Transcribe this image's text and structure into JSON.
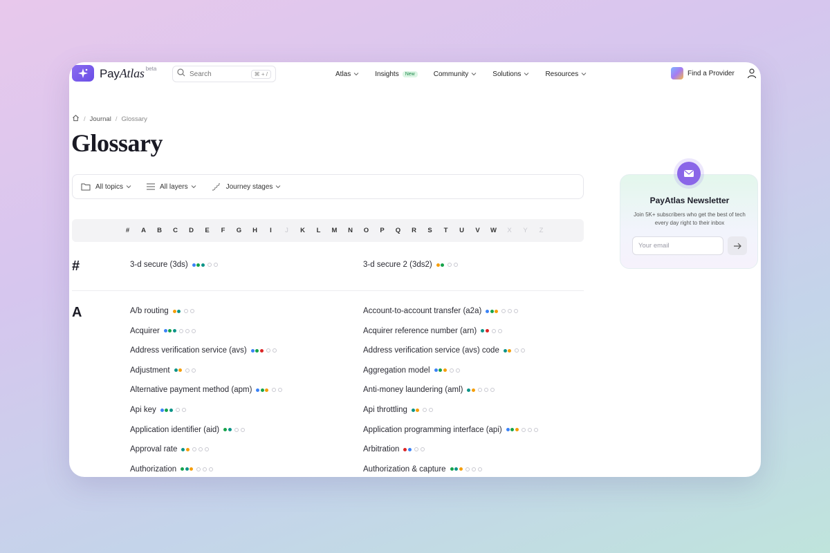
{
  "header": {
    "logo_text": "Pay",
    "logo_text_italic": "Atlas",
    "logo_badge": "beta",
    "search_placeholder": "Search",
    "search_shortcut": "⌘ + /",
    "nav": [
      {
        "label": "Atlas",
        "chevron": true
      },
      {
        "label": "Insights",
        "badge": "New"
      },
      {
        "label": "Community",
        "chevron": true
      },
      {
        "label": "Solutions",
        "chevron": true
      },
      {
        "label": "Resources",
        "chevron": true
      }
    ],
    "find_provider": "Find a Provider"
  },
  "breadcrumb": {
    "items": [
      "Journal",
      "Glossary"
    ]
  },
  "page_title": "Glossary",
  "filters": {
    "topics": "All topics",
    "layers": "All layers",
    "stages": "Journey stages"
  },
  "alphabet": [
    {
      "l": "#",
      "on": true
    },
    {
      "l": "A",
      "on": true
    },
    {
      "l": "B",
      "on": true
    },
    {
      "l": "C",
      "on": true
    },
    {
      "l": "D",
      "on": true
    },
    {
      "l": "E",
      "on": true
    },
    {
      "l": "F",
      "on": true
    },
    {
      "l": "G",
      "on": true
    },
    {
      "l": "H",
      "on": true
    },
    {
      "l": "I",
      "on": true
    },
    {
      "l": "J",
      "on": false
    },
    {
      "l": "K",
      "on": true
    },
    {
      "l": "L",
      "on": true
    },
    {
      "l": "M",
      "on": true
    },
    {
      "l": "N",
      "on": true
    },
    {
      "l": "O",
      "on": true
    },
    {
      "l": "P",
      "on": true
    },
    {
      "l": "Q",
      "on": true
    },
    {
      "l": "R",
      "on": true
    },
    {
      "l": "S",
      "on": true
    },
    {
      "l": "T",
      "on": true
    },
    {
      "l": "U",
      "on": true
    },
    {
      "l": "V",
      "on": true
    },
    {
      "l": "W",
      "on": true
    },
    {
      "l": "X",
      "on": false
    },
    {
      "l": "Y",
      "on": false
    },
    {
      "l": "Z",
      "on": false
    }
  ],
  "colors": {
    "blue": "#3b82f6",
    "green": "#16a34a",
    "teal": "#0d9488",
    "orange": "#f59e0b",
    "red": "#dc2626"
  },
  "sections": [
    {
      "letter": "#",
      "left": [
        {
          "term": "3-d secure (3ds)",
          "dots": [
            "blue",
            "green",
            "teal"
          ],
          "icons": 2
        }
      ],
      "right": [
        {
          "term": "3-d secure 2 (3ds2)",
          "dots": [
            "orange",
            "green"
          ],
          "icons": 2
        }
      ]
    },
    {
      "letter": "A",
      "left": [
        {
          "term": "A/b routing",
          "dots": [
            "orange",
            "teal"
          ],
          "icons": 2
        },
        {
          "term": "Acquirer",
          "dots": [
            "blue",
            "green",
            "teal"
          ],
          "icons": 3
        },
        {
          "term": "Address verification service (avs)",
          "dots": [
            "blue",
            "green",
            "red"
          ],
          "icons": 2
        },
        {
          "term": "Adjustment",
          "dots": [
            "teal",
            "orange"
          ],
          "icons": 2
        },
        {
          "term": "Alternative payment method (apm)",
          "dots": [
            "blue",
            "green",
            "orange"
          ],
          "icons": 2
        },
        {
          "term": "Api key",
          "dots": [
            "blue",
            "green",
            "teal"
          ],
          "icons": 2
        },
        {
          "term": "Application identifier (aid)",
          "dots": [
            "green",
            "teal"
          ],
          "icons": 2
        },
        {
          "term": "Approval rate",
          "dots": [
            "teal",
            "orange"
          ],
          "icons": 3
        },
        {
          "term": "Authorization",
          "dots": [
            "green",
            "teal",
            "orange"
          ],
          "icons": 3
        }
      ],
      "right": [
        {
          "term": "Account-to-account transfer (a2a)",
          "dots": [
            "blue",
            "green",
            "orange"
          ],
          "icons": 3
        },
        {
          "term": "Acquirer reference number (arn)",
          "dots": [
            "teal",
            "red"
          ],
          "icons": 2
        },
        {
          "term": "Address verification service (avs) code",
          "dots": [
            "teal",
            "orange"
          ],
          "icons": 2
        },
        {
          "term": "Aggregation model",
          "dots": [
            "blue",
            "green",
            "orange"
          ],
          "icons": 2
        },
        {
          "term": "Anti-money laundering (aml)",
          "dots": [
            "teal",
            "orange"
          ],
          "icons": 3
        },
        {
          "term": "Api throttling",
          "dots": [
            "teal",
            "orange"
          ],
          "icons": 2
        },
        {
          "term": "Application programming interface (api)",
          "dots": [
            "blue",
            "green",
            "orange"
          ],
          "icons": 3
        },
        {
          "term": "Arbitration",
          "dots": [
            "red",
            "blue"
          ],
          "icons": 2
        },
        {
          "term": "Authorization & capture",
          "dots": [
            "green",
            "teal",
            "orange"
          ],
          "icons": 3
        }
      ]
    }
  ],
  "newsletter": {
    "title": "PayAtlas Newsletter",
    "description": "Join 5K+ subscribers who get the best of tech every day right to their inbox",
    "email_placeholder": "Your email"
  }
}
